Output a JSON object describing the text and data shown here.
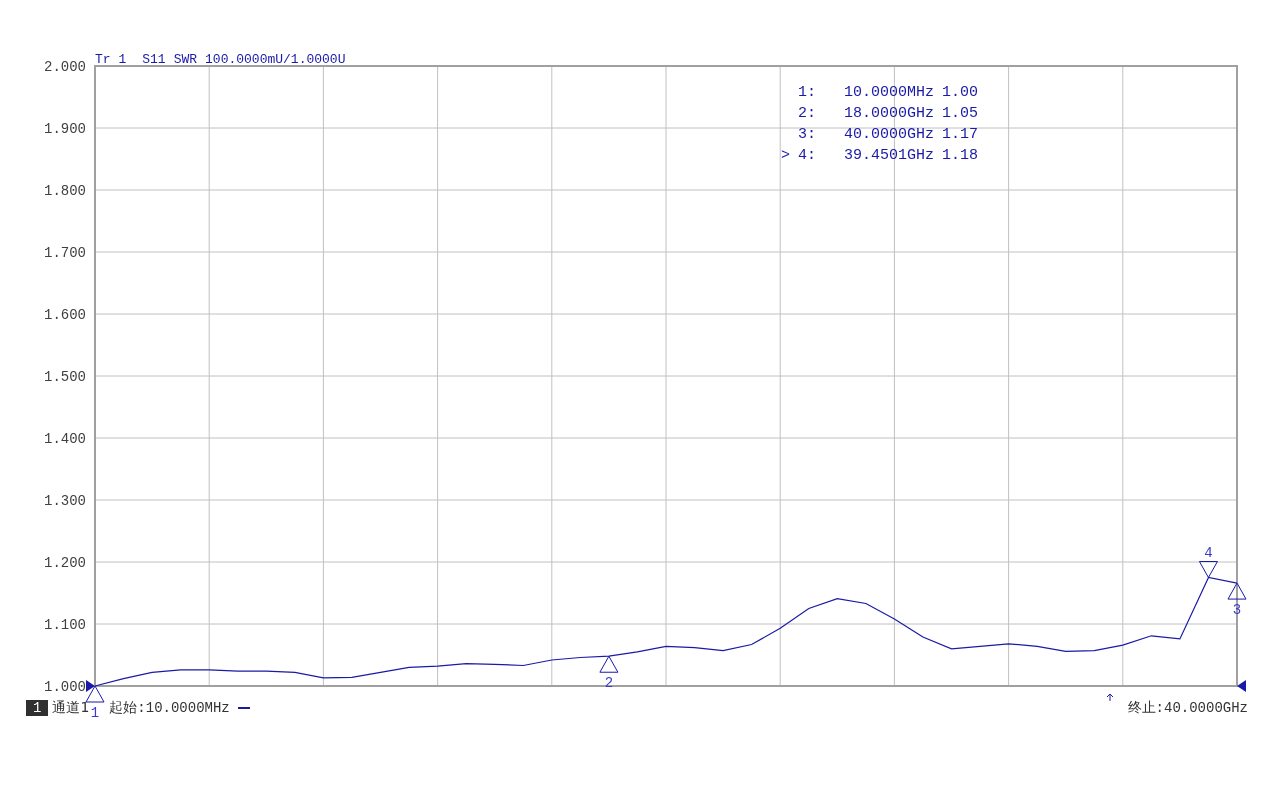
{
  "trace_header": {
    "trace": "Tr 1",
    "format": "SWR",
    "scale": "100.0000mU/1.0000U"
  },
  "chart_data": {
    "type": "line",
    "ylim": [
      1,
      2
    ],
    "yticks": [
      {
        "value": 1,
        "label": "1.000"
      },
      {
        "value": 1.1,
        "label": "1.100"
      },
      {
        "value": 1.2,
        "label": "1.200"
      },
      {
        "value": 1.3,
        "label": "1.300"
      },
      {
        "value": 1.4,
        "label": "1.400"
      },
      {
        "value": 1.5,
        "label": "1.500"
      },
      {
        "value": 1.6,
        "label": "1.600"
      },
      {
        "value": 1.7,
        "label": "1.700"
      },
      {
        "value": 1.8,
        "label": "1.800"
      },
      {
        "value": 1.9,
        "label": "1.900"
      },
      {
        "value": 2,
        "label": "2.000"
      }
    ],
    "categories": [
      null,
      null,
      null,
      null,
      null,
      null,
      null,
      null,
      null,
      null,
      null,
      null,
      null,
      null,
      null,
      null,
      null,
      null,
      null,
      null,
      null,
      null,
      null,
      null,
      null,
      null,
      null,
      null,
      null,
      null,
      null,
      null,
      null,
      null,
      null,
      null,
      null,
      null,
      null,
      null,
      null
    ],
    "series": [
      {
        "name": "S11",
        "color": "#1a1aa8",
        "values": [
          1.0,
          1.012,
          1.022,
          1.026,
          1.026,
          1.024,
          1.024,
          1.022,
          1.013,
          1.014,
          1.022,
          1.03,
          1.032,
          1.036,
          1.035,
          1.033,
          1.042,
          1.046,
          1.048,
          1.055,
          1.064,
          1.062,
          1.057,
          1.067,
          1.093,
          1.125,
          1.141,
          1.133,
          1.108,
          1.079,
          1.06,
          1.064,
          1.068,
          1.064,
          1.056,
          1.057,
          1.066,
          1.081,
          1.076,
          1.175,
          1.166
        ]
      }
    ],
    "grid": true,
    "annotations": [
      {
        "y": 1.0,
        "text": "1"
      },
      {
        "y": 1.048,
        "text": "2"
      },
      {
        "y": 1.166,
        "text": "3"
      },
      {
        "y": 1.175,
        "text": "4"
      }
    ]
  },
  "marker_readout": [
    {
      "index": "1:",
      "frequency": "10.0000MHz",
      "value": "1.00"
    },
    {
      "index": "2:",
      "frequency": "18.0000GHz",
      "value": "1.05"
    },
    {
      "index": "3:",
      "frequency": "40.0000GHz",
      "value": "1.17"
    },
    {
      "pointer": ">",
      "index": "4:",
      "frequency": "39.4501GHz",
      "value": "1.18"
    }
  ],
  "status_bar": {
    "channel_number": "1",
    "channel": "通道1",
    "start": "起始:10.0000MHz",
    "stop": "终止:40.0000GHz"
  }
}
